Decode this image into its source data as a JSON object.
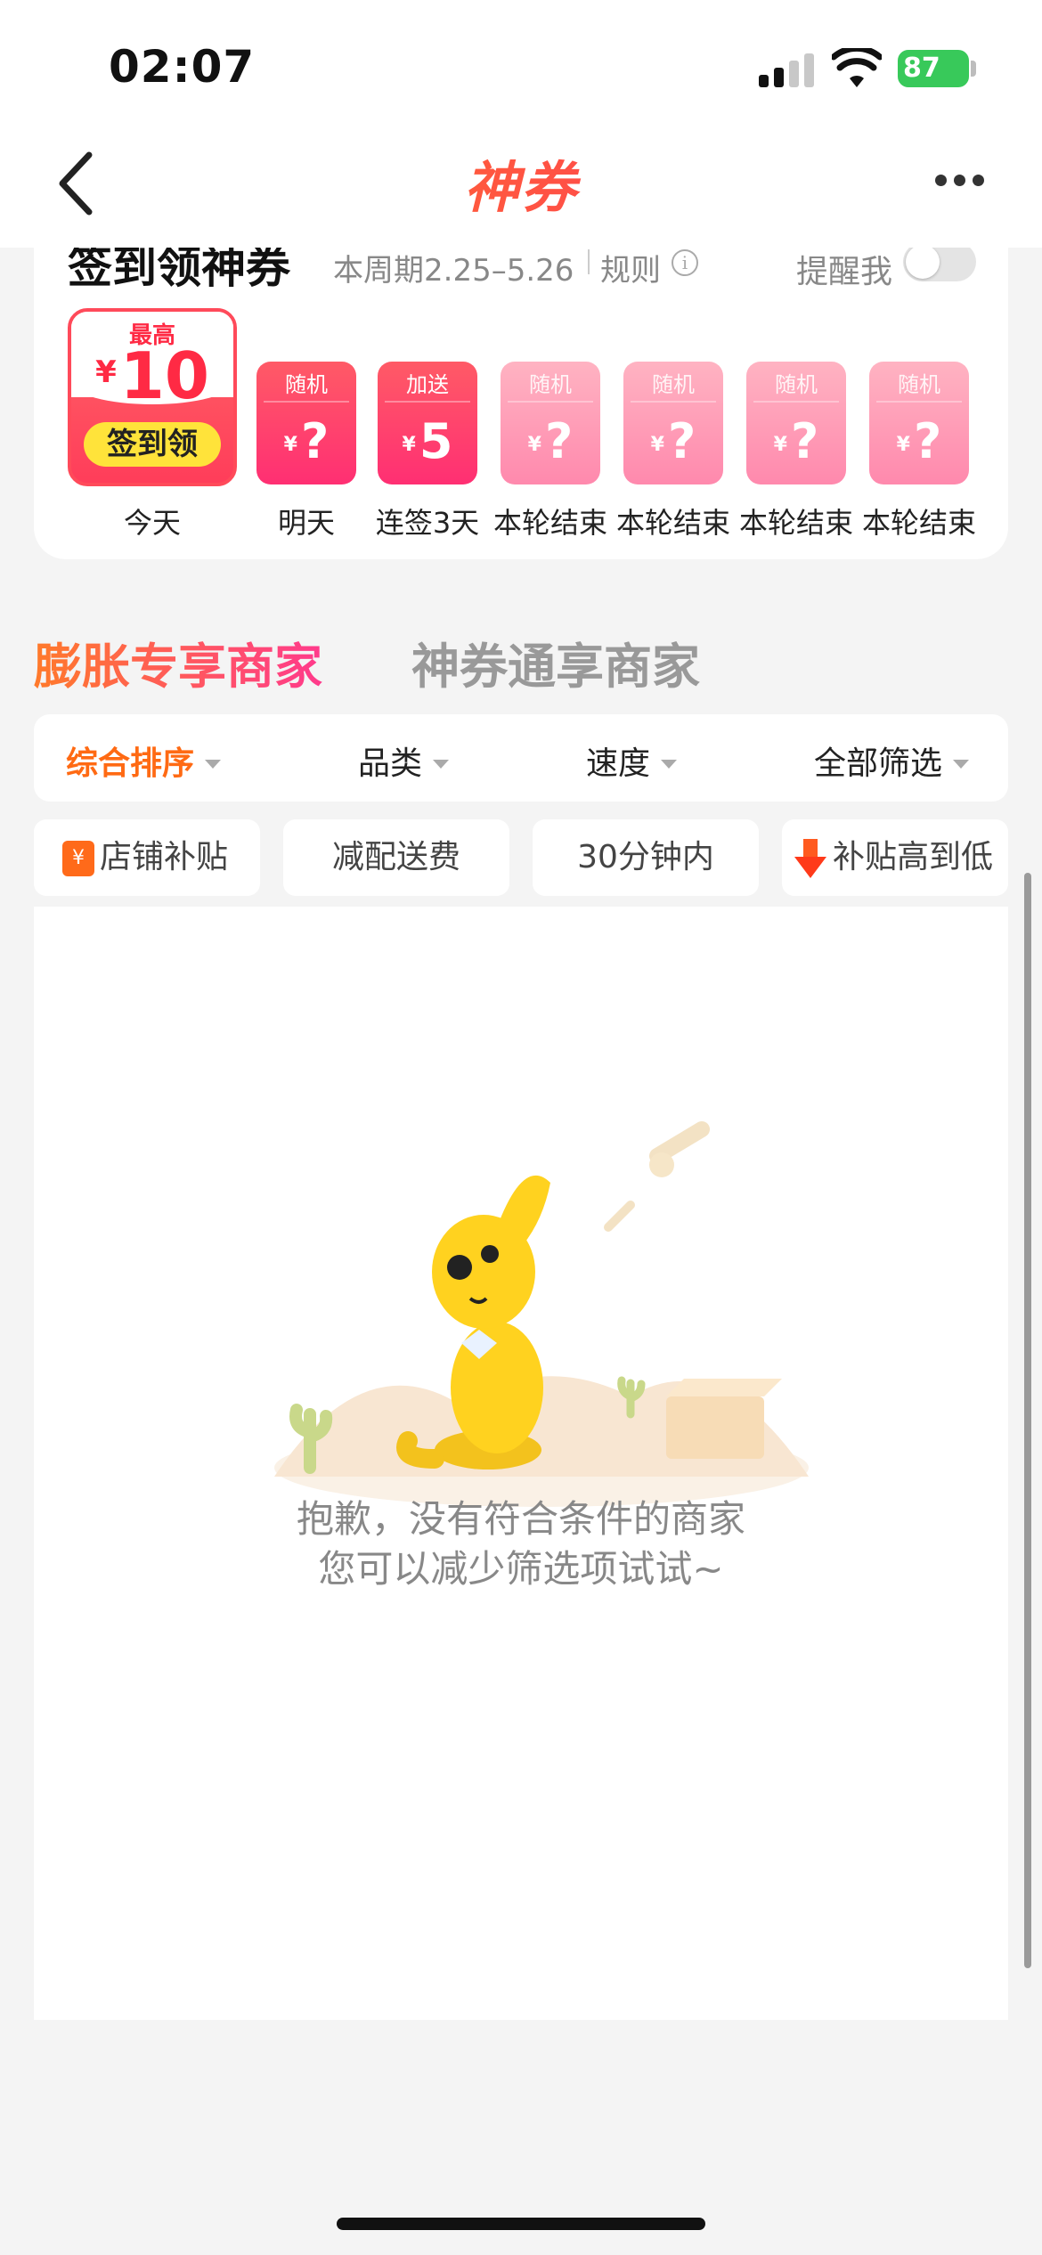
{
  "status_bar": {
    "time": "02:07",
    "battery": "87"
  },
  "nav": {
    "title": "神券"
  },
  "signin": {
    "title": "签到领神券",
    "period": "本周期2.25–5.26",
    "rules": "规则",
    "remind_label": "提醒我",
    "today": {
      "label": "最高",
      "currency": "¥",
      "amount": "10",
      "button": "签到领",
      "day": "今天"
    },
    "days": [
      {
        "tag": "随机",
        "currency": "¥",
        "value": "?",
        "day": "明天"
      },
      {
        "tag": "加送",
        "currency": "¥",
        "value": "5",
        "day": "连签3天"
      },
      {
        "tag": "随机",
        "currency": "¥",
        "value": "?",
        "day": "本轮结束"
      },
      {
        "tag": "随机",
        "currency": "¥",
        "value": "?",
        "day": "本轮结束"
      },
      {
        "tag": "随机",
        "currency": "¥",
        "value": "?",
        "day": "本轮结束"
      },
      {
        "tag": "随机",
        "currency": "¥",
        "value": "?",
        "day": "本轮结束"
      }
    ]
  },
  "tabs": [
    {
      "label": "膨胀专享商家"
    },
    {
      "label": "神券通享商家"
    }
  ],
  "filters": [
    {
      "label": "综合排序"
    },
    {
      "label": "品类"
    },
    {
      "label": "速度"
    },
    {
      "label": "全部筛选"
    }
  ],
  "chips": [
    {
      "label": "店铺补贴",
      "icon": "shop-subsidy-icon",
      "icon_glyph": "¥"
    },
    {
      "label": "减配送费"
    },
    {
      "label": "30分钟内"
    },
    {
      "label": "补贴高到低",
      "icon": "arrow-down-icon"
    }
  ],
  "empty_state": {
    "line1": "抱歉，没有符合条件的商家",
    "line2": "您可以减少筛选项试试~"
  },
  "colors": {
    "accent": "#ff6a13",
    "coupon_red": "#ff2f6a",
    "coupon_yellow": "#ffe33a"
  }
}
